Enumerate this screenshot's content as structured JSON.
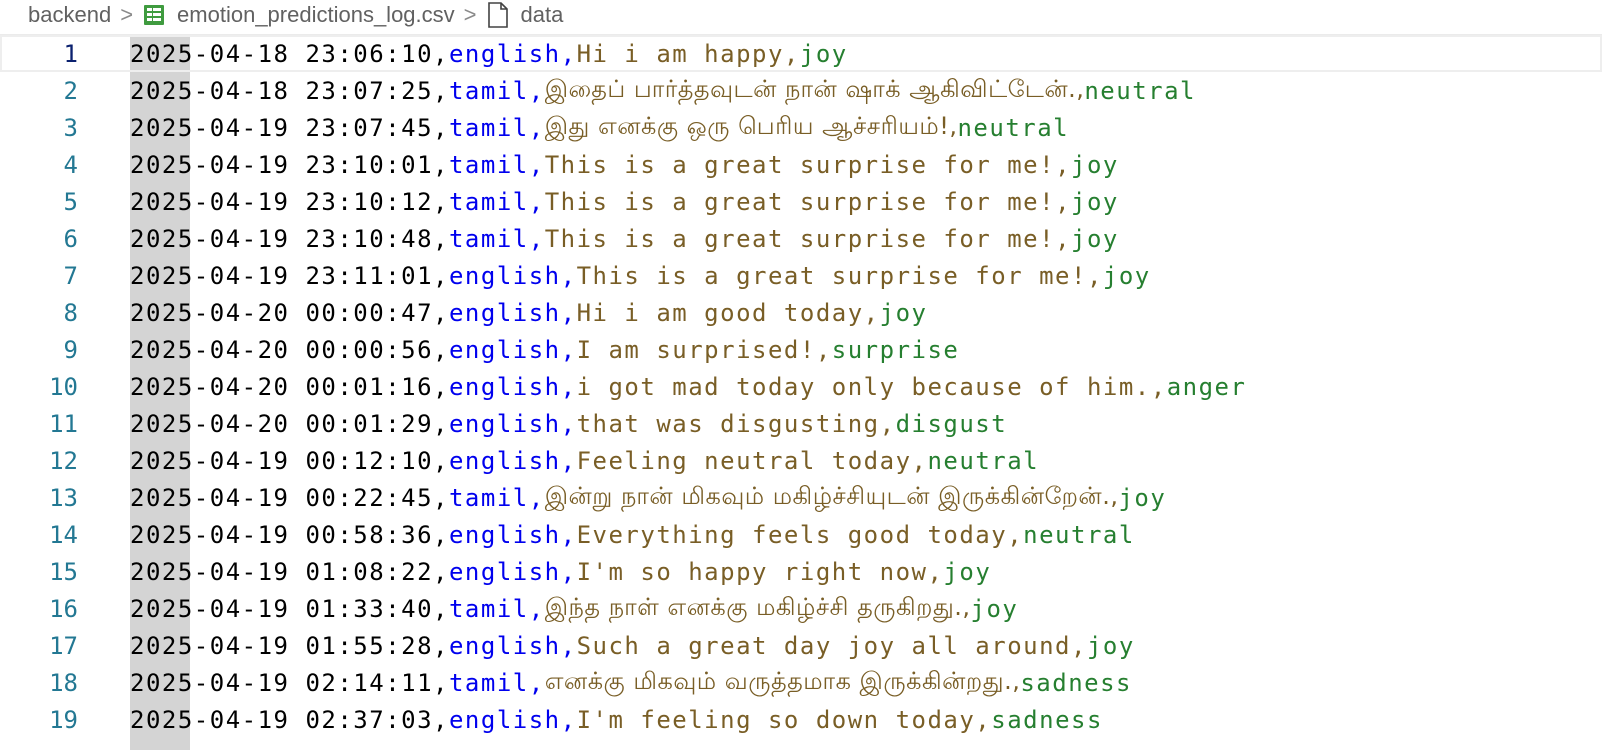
{
  "breadcrumb": {
    "folder": "backend",
    "file": "emotion_predictions_log.csv",
    "symbol": "data",
    "separator": ">",
    "file_icon": "csv-table-icon",
    "symbol_icon": "file-icon"
  },
  "colors": {
    "timestamp": "#000000",
    "language": "#0000ee",
    "text": "#795e26",
    "emotion": "#267f30",
    "line_number": "#237893"
  },
  "lines": [
    {
      "num": "1",
      "time": "2025-04-18 23:06:10,",
      "lang": "english,",
      "text": "Hi i am happy,",
      "emotion": "joy"
    },
    {
      "num": "2",
      "time": "2025-04-18 23:07:25,",
      "lang": "tamil,",
      "text": "இதைப் பார்த்தவுடன் நான் ஷாக் ஆகிவிட்டேன்.,",
      "emotion": "neutral"
    },
    {
      "num": "3",
      "time": "2025-04-19 23:07:45,",
      "lang": "tamil,",
      "text": "இது எனக்கு ஒரு பெரிய ஆச்சரியம்!,",
      "emotion": "neutral"
    },
    {
      "num": "4",
      "time": "2025-04-19 23:10:01,",
      "lang": "tamil,",
      "text": "This is a great surprise for me!,",
      "emotion": "joy"
    },
    {
      "num": "5",
      "time": "2025-04-19 23:10:12,",
      "lang": "tamil,",
      "text": "This is a great surprise for me!,",
      "emotion": "joy"
    },
    {
      "num": "6",
      "time": "2025-04-19 23:10:48,",
      "lang": "tamil,",
      "text": "This is a great surprise for me!,",
      "emotion": "joy"
    },
    {
      "num": "7",
      "time": "2025-04-19 23:11:01,",
      "lang": "english,",
      "text": "This is a great surprise for me!,",
      "emotion": "joy"
    },
    {
      "num": "8",
      "time": "2025-04-20 00:00:47,",
      "lang": "english,",
      "text": "Hi i am good today,",
      "emotion": "joy"
    },
    {
      "num": "9",
      "time": "2025-04-20 00:00:56,",
      "lang": "english,",
      "text": "I am surprised!,",
      "emotion": "surprise"
    },
    {
      "num": "10",
      "time": "2025-04-20 00:01:16,",
      "lang": "english,",
      "text": "i got mad today only because of him.,",
      "emotion": "anger"
    },
    {
      "num": "11",
      "time": "2025-04-20 00:01:29,",
      "lang": "english,",
      "text": "that was disgusting,",
      "emotion": "disgust"
    },
    {
      "num": "12",
      "time": "2025-04-19 00:12:10,",
      "lang": "english,",
      "text": "Feeling neutral today,",
      "emotion": "neutral"
    },
    {
      "num": "13",
      "time": "2025-04-19 00:22:45,",
      "lang": "tamil,",
      "text": "இன்று நான் மிகவும் மகிழ்ச்சியுடன் இருக்கின்றேன்.,",
      "emotion": "joy"
    },
    {
      "num": "14",
      "time": "2025-04-19 00:58:36,",
      "lang": "english,",
      "text": "Everything feels good today,",
      "emotion": "neutral"
    },
    {
      "num": "15",
      "time": "2025-04-19 01:08:22,",
      "lang": "english,",
      "text": "I'm so happy right now,",
      "emotion": "joy"
    },
    {
      "num": "16",
      "time": "2025-04-19 01:33:40,",
      "lang": "tamil,",
      "text": "இந்த நாள் எனக்கு மகிழ்ச்சி தருகிறது.,",
      "emotion": "joy"
    },
    {
      "num": "17",
      "time": "2025-04-19 01:55:28,",
      "lang": "english,",
      "text": "Such a great day joy all around,",
      "emotion": "joy"
    },
    {
      "num": "18",
      "time": "2025-04-19 02:14:11,",
      "lang": "tamil,",
      "text": "எனக்கு மிகவும் வருத்தமாக இருக்கின்றது.,",
      "emotion": "sadness"
    },
    {
      "num": "19",
      "time": "2025-04-19 02:37:03,",
      "lang": "english,",
      "text": "I'm feeling so down today,",
      "emotion": "sadness"
    }
  ]
}
